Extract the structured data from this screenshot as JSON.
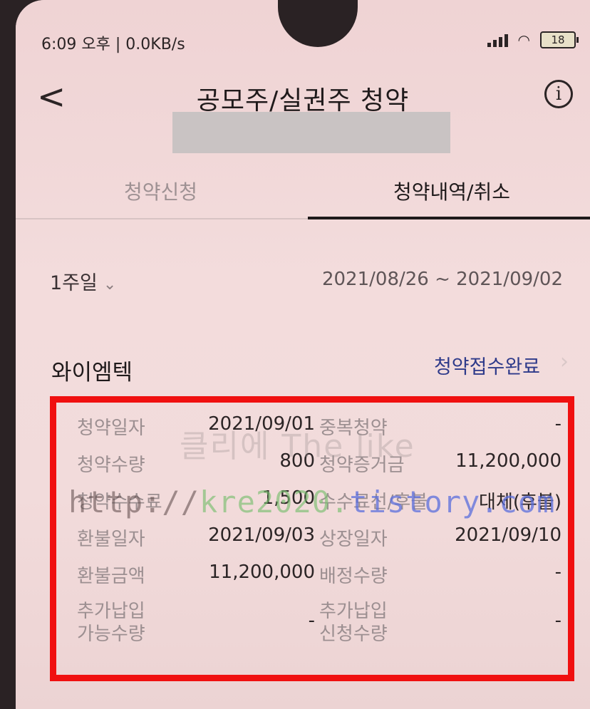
{
  "status_bar": {
    "time_text": "6:09 오후 | 0.0KB/s",
    "battery": "18"
  },
  "header": {
    "back_label": "<",
    "title": "공모주/실권주 청약",
    "info_label": "i"
  },
  "tabs": [
    {
      "label": "청약신청",
      "active": false
    },
    {
      "label": "청약내역/취소",
      "active": true
    }
  ],
  "filter": {
    "period": "1주일",
    "date_range": "2021/08/26 ~ 2021/09/02"
  },
  "stock": {
    "name": "와이엠텍",
    "status": "청약접수완료"
  },
  "details": [
    {
      "label1": "청약일자",
      "value1": "2021/09/01",
      "label2": "중복청약",
      "value2": "-"
    },
    {
      "label1": "청약수량",
      "value1": "800",
      "label2": "청약증거금",
      "value2": "11,200,000"
    },
    {
      "label1": "청약수수료",
      "value1": "1,500",
      "label2": "수수료선/후불",
      "value2": "대체(후불)"
    },
    {
      "label1": "환불일자",
      "value1": "2021/09/03",
      "label2": "상장일자",
      "value2": "2021/09/10"
    },
    {
      "label1": "환불금액",
      "value1": "11,200,000",
      "label2": "배정수량",
      "value2": "-"
    },
    {
      "label1a": "추가납입",
      "label1b": "가능수량",
      "value1": "-",
      "label2a": "추가납입",
      "label2b": "신청수량",
      "value2": "-"
    }
  ],
  "watermark": {
    "line1": "클리에 The like",
    "line2_a": "http://",
    "line2_b": "kre2020.",
    "line2_c": "tistory.com"
  },
  "colors": {
    "highlight_box": "#f01010",
    "status_text": "#2e3a8a",
    "background": "#f0d8d8"
  }
}
